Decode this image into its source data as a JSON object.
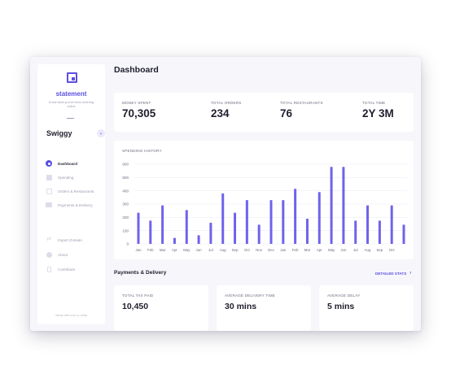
{
  "sidebar": {
    "brand": "statement",
    "tagline": "Know what you've been ordering online",
    "platform": "Swiggy",
    "nav": [
      {
        "label": "Dashboard",
        "icon": "dashboard-icon",
        "active": true
      },
      {
        "label": "Spending",
        "icon": "spending-icon",
        "active": false
      },
      {
        "label": "Orders & Restaurants",
        "icon": "orders-icon",
        "active": false
      },
      {
        "label": "Payments & Delivery",
        "icon": "payments-icon",
        "active": false
      }
    ],
    "secondary": [
      {
        "label": "Import Zomato",
        "icon": "import-icon"
      },
      {
        "label": "About",
        "icon": "about-icon"
      },
      {
        "label": "Contribute",
        "icon": "contribute-icon"
      }
    ],
    "footer": "Made with love in India"
  },
  "main": {
    "title": "Dashboard",
    "stats": [
      {
        "label": "MONEY SPENT",
        "value": "70,305"
      },
      {
        "label": "TOTAL ORDERS",
        "value": "234"
      },
      {
        "label": "TOTAL RESTAURANTS",
        "value": "76"
      },
      {
        "label": "TOTAL TIME",
        "value": "2Y 3M"
      }
    ],
    "chart_title": "SPENDING HISTORY",
    "payments_title": "Payments & Delivery",
    "detailed_link": "DETAILED STATS",
    "payment_stats": [
      {
        "label": "TOTAL TAX PAID",
        "value": "10,450"
      },
      {
        "label": "AVERAGE DELIVERY TIME",
        "value": "30 mins"
      },
      {
        "label": "AVERAGE DELAY",
        "value": "5 mins"
      }
    ]
  },
  "colors": {
    "accent": "#5b4fe0",
    "bar": "#6f63ea",
    "background": "#f6f6fb"
  },
  "chart_data": {
    "type": "bar",
    "title": "SPENDING HISTORY",
    "xlabel": "",
    "ylabel": "",
    "ylim": [
      0,
      600
    ],
    "yticks": [
      0,
      100,
      200,
      300,
      400,
      500,
      600
    ],
    "grid": true,
    "categories": [
      "Jan",
      "Feb",
      "Mar",
      "Apr",
      "May",
      "Jun",
      "Jul",
      "Aug",
      "Sep",
      "Oct",
      "Nov",
      "Dec",
      "Jan",
      "Feb",
      "Mar",
      "Apr",
      "May",
      "Jun",
      "Jul",
      "Aug",
      "Sep",
      "Oct"
    ],
    "values": [
      235,
      175,
      290,
      45,
      255,
      65,
      160,
      380,
      235,
      330,
      145,
      330,
      330,
      415,
      190,
      390,
      580,
      580,
      175,
      290,
      175,
      290,
      145
    ]
  }
}
